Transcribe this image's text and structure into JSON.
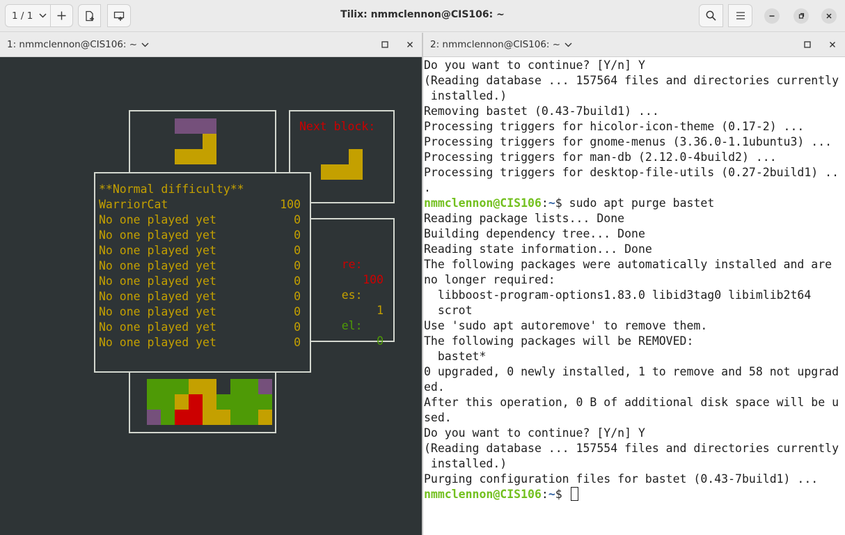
{
  "window": {
    "title": "Tilix: nmmclennon@CIS106: ~",
    "session_selector": "1 / 1"
  },
  "icons": {
    "chevron": "chevron-down-icon",
    "add": "plus-icon",
    "search": "search-icon",
    "menu": "hamburger-menu-icon",
    "minimize": "minimize-icon",
    "maximize": "maximize-icon",
    "close": "close-icon"
  },
  "panes": {
    "left": {
      "title": "1: nmmclennon@CIS106: ~"
    },
    "right": {
      "title": "2: nmmclennon@CIS106: ~"
    }
  },
  "bastet": {
    "next_label": "Next block:",
    "highscores_title": "**Normal difficulty**",
    "highscores": [
      {
        "name": "WarriorCat",
        "score": "100"
      },
      {
        "name": "No one played yet",
        "score": "0"
      },
      {
        "name": "No one played yet",
        "score": "0"
      },
      {
        "name": "No one played yet",
        "score": "0"
      },
      {
        "name": "No one played yet",
        "score": "0"
      },
      {
        "name": "No one played yet",
        "score": "0"
      },
      {
        "name": "No one played yet",
        "score": "0"
      },
      {
        "name": "No one played yet",
        "score": "0"
      },
      {
        "name": "No one played yet",
        "score": "0"
      },
      {
        "name": "No one played yet",
        "score": "0"
      }
    ],
    "side_stats": [
      {
        "label": "re:",
        "value": "100",
        "color": "#cc0000"
      },
      {
        "label": "es:",
        "value": "1",
        "color": "#c4a000"
      },
      {
        "label": "el:",
        "value": "0",
        "color": "#4e9a06"
      }
    ],
    "colors": {
      "purple": "#75507b",
      "yellow": "#c4a000",
      "green": "#4e9a06",
      "red": "#cc0000",
      "background": "#2e3436"
    }
  },
  "terminal": {
    "prompt_user": "nmmclennon@CIS106",
    "prompt_path": "~",
    "prompt_suffix": "$ ",
    "lines": [
      {
        "text": "Do you want to continue? [Y/n] Y"
      },
      {
        "text": "(Reading database ... 157564 files and directories currently"
      },
      {
        "text": " installed.)"
      },
      {
        "text": "Removing bastet (0.43-7build1) ..."
      },
      {
        "text": "Processing triggers for hicolor-icon-theme (0.17-2) ..."
      },
      {
        "text": "Processing triggers for gnome-menus (3.36.0-1.1ubuntu3) ..."
      },
      {
        "text": "Processing triggers for man-db (2.12.0-4build2) ..."
      },
      {
        "text": "Processing triggers for desktop-file-utils (0.27-2build1) .."
      },
      {
        "text": "."
      },
      {
        "prompt": true,
        "text": "sudo apt purge bastet"
      },
      {
        "text": "Reading package lists... Done"
      },
      {
        "text": "Building dependency tree... Done"
      },
      {
        "text": "Reading state information... Done"
      },
      {
        "text": "The following packages were automatically installed and are"
      },
      {
        "text": "no longer required:"
      },
      {
        "text": "  libboost-program-options1.83.0 libid3tag0 libimlib2t64"
      },
      {
        "text": "  scrot"
      },
      {
        "text": "Use 'sudo apt autoremove' to remove them."
      },
      {
        "text": "The following packages will be REMOVED:"
      },
      {
        "text": "  bastet*"
      },
      {
        "text": "0 upgraded, 0 newly installed, 1 to remove and 58 not upgrad"
      },
      {
        "text": "ed."
      },
      {
        "text": "After this operation, 0 B of additional disk space will be u"
      },
      {
        "text": "sed."
      },
      {
        "text": "Do you want to continue? [Y/n] Y"
      },
      {
        "text": "(Reading database ... 157554 files and directories currently"
      },
      {
        "text": " installed.)"
      },
      {
        "text": "Purging configuration files for bastet (0.43-7build1) ..."
      },
      {
        "prompt": true,
        "text": "",
        "cursor": true
      }
    ]
  }
}
